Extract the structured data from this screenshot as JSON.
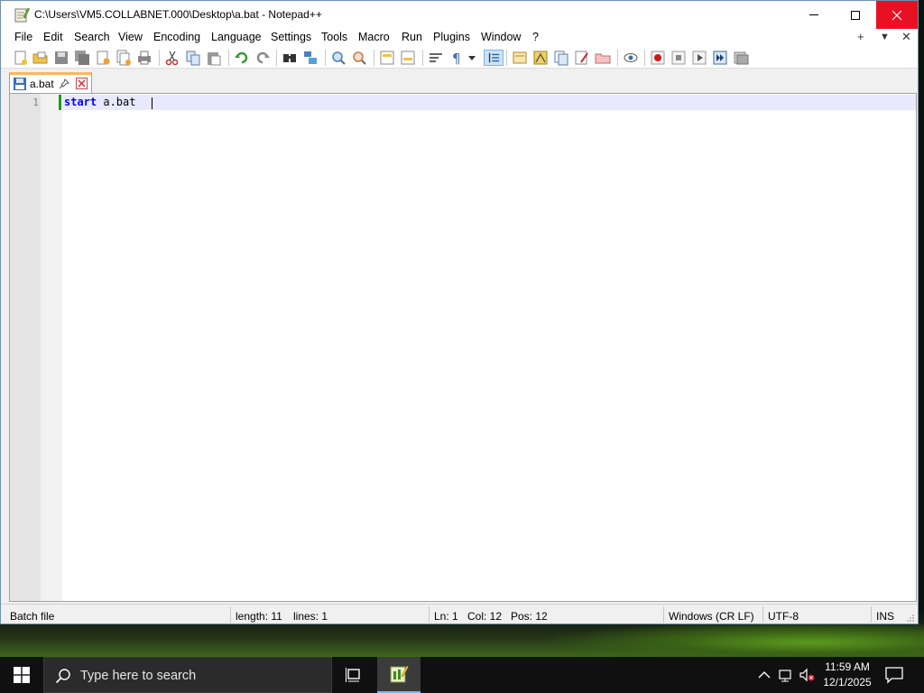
{
  "window": {
    "title": "C:\\Users\\VM5.COLLABNET.000\\Desktop\\a.bat - Notepad++",
    "close_color": "#e81123"
  },
  "menu": {
    "items": [
      "File",
      "Edit",
      "Search",
      "View",
      "Encoding",
      "Language",
      "Settings",
      "Tools",
      "Macro",
      "Run",
      "Plugins",
      "Window",
      "?"
    ],
    "right": [
      "+",
      "▼",
      "✕"
    ]
  },
  "toolbar": {
    "icons": [
      "new-file-icon",
      "open-file-icon",
      "save-icon",
      "save-all-icon",
      "close-icon",
      "close-all-icon",
      "print-icon",
      "cut-icon",
      "copy-icon",
      "paste-icon",
      "undo-icon",
      "redo-icon",
      "find-icon",
      "replace-icon",
      "zoom-in-icon",
      "zoom-out-icon",
      "sync-vertical-icon",
      "sync-horizontal-icon",
      "word-wrap-icon",
      "show-all-chars-icon",
      "indent-guide-icon",
      "user-lang-icon",
      "doc-map-icon",
      "function-list-icon",
      "folder-workspace-icon",
      "monitoring-icon",
      "record-macro-icon",
      "stop-record-icon",
      "play-macro-icon",
      "run-macro-multiple-icon",
      "save-macro-icon"
    ]
  },
  "tab": {
    "label": "a.bat"
  },
  "editor": {
    "line_number": "1",
    "keyword": "start",
    "rest": " a.bat"
  },
  "status": {
    "filetype": "Batch file",
    "length": "length: 11",
    "lines": "lines: 1",
    "ln": "Ln: 1",
    "col": "Col: 12",
    "pos": "Pos: 12",
    "eol": "Windows (CR LF)",
    "encoding": "UTF-8",
    "mode": "INS"
  },
  "taskbar": {
    "search_placeholder": "Type here to search",
    "time": "11:59 AM",
    "date": "12/1/2025"
  }
}
